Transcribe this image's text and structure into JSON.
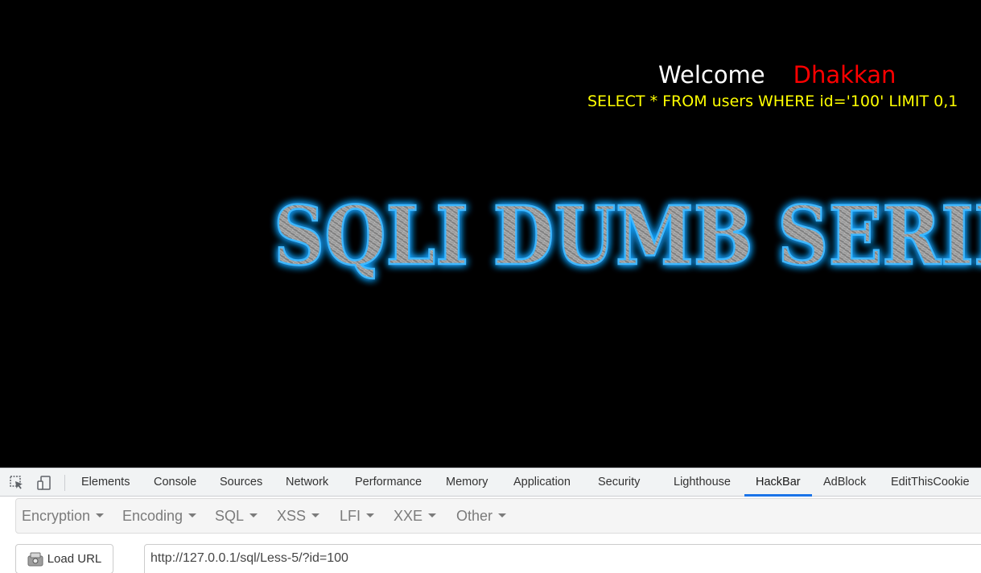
{
  "page": {
    "welcome_word": "Welcome",
    "welcome_name": "Dhakkan",
    "query": "SELECT * FROM users WHERE id='100' LIMIT 0,1",
    "banner_text": "SQLI DUMB SERIES",
    "colors": {
      "background": "#000000",
      "welcome": "#ffffff",
      "name": "#ff0000",
      "query": "#ffff00",
      "banner_glow": "#1aa8ff"
    }
  },
  "devtools": {
    "tool_icons": [
      "inspect-element-icon",
      "device-toolbar-icon"
    ],
    "tabs": [
      {
        "label": "Elements"
      },
      {
        "label": "Console"
      },
      {
        "label": "Sources"
      },
      {
        "label": "Network"
      },
      {
        "label": "Performance"
      },
      {
        "label": "Memory"
      },
      {
        "label": "Application"
      },
      {
        "label": "Security"
      },
      {
        "label": "Lighthouse"
      },
      {
        "label": "HackBar",
        "active": true
      },
      {
        "label": "AdBlock"
      },
      {
        "label": "EditThisCookie"
      }
    ],
    "accent_color": "#1a73e8"
  },
  "hackbar": {
    "menus": [
      {
        "label": "Encryption"
      },
      {
        "label": "Encoding"
      },
      {
        "label": "SQL"
      },
      {
        "label": "XSS"
      },
      {
        "label": "LFI"
      },
      {
        "label": "XXE"
      },
      {
        "label": "Other"
      }
    ],
    "load_url_label": "Load URL",
    "url_value": "http://127.0.0.1/sql/Less-5/?id=100"
  }
}
